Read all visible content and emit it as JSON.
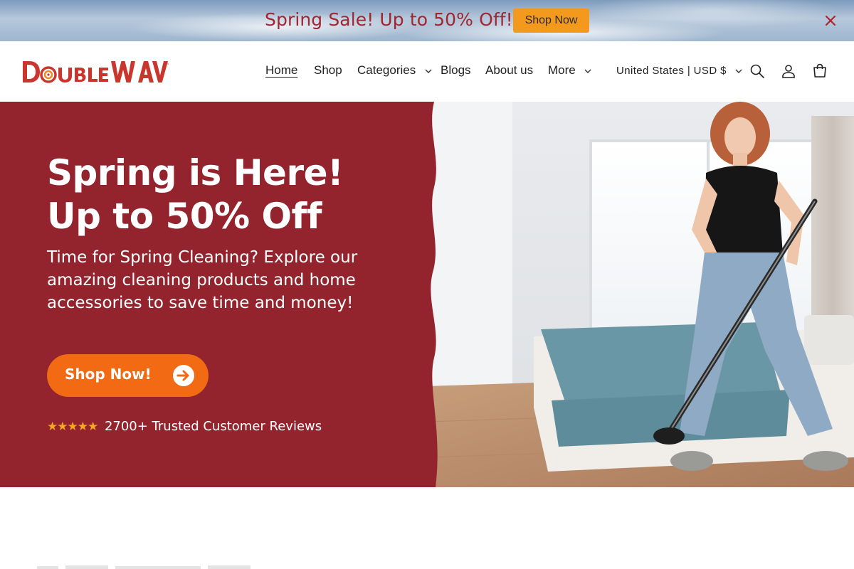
{
  "announcement": {
    "text": "Spring Sale! Up to 50% Off!",
    "button_label": "Shop Now",
    "close_icon": "close-icon"
  },
  "header": {
    "logo_text": "DoubleWave",
    "nav": [
      {
        "label": "Home",
        "active": true
      },
      {
        "label": "Shop"
      },
      {
        "label": "Categories",
        "has_dropdown": true
      },
      {
        "label": "Blogs"
      },
      {
        "label": "About us"
      },
      {
        "label": "More",
        "has_dropdown": true
      }
    ],
    "locale": "United States | USD $",
    "icons": [
      "search-icon",
      "account-icon",
      "cart-icon"
    ]
  },
  "hero": {
    "title": "Spring is Here! Up to 50% Off",
    "subtitle": "Time for Spring Cleaning? Explore our amazing cleaning products and home accessories to save time and money!",
    "cta_label": "Shop Now!",
    "stars": "★★★★★",
    "reviews_text": "2700+ Trusted Customer Reviews"
  },
  "colors": {
    "brand_red": "#93232c",
    "announce_text": "#a12630",
    "cta_orange": "#f26a14",
    "announce_button": "#f39a1e",
    "star": "#f5a623"
  }
}
